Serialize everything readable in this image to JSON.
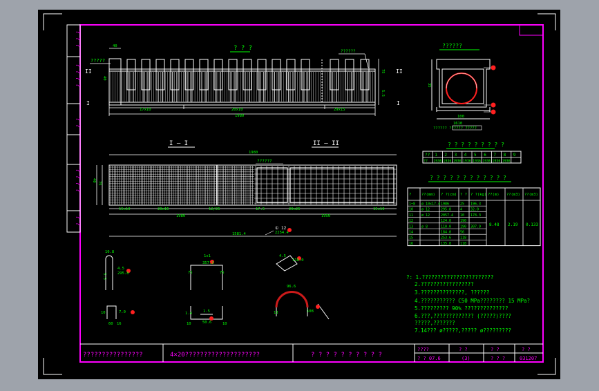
{
  "colors": {
    "outer_bg": "#9ea3ab",
    "sheet_bg": "#000000",
    "frame": "#ff00ff",
    "line": "#ffffff",
    "text": "#00ff00",
    "note_green": "#00ff00",
    "marker": "#ff0000",
    "crimson": "#cc1a1a"
  },
  "side_labels": [
    "? ? ?",
    "? ? ? ?",
    "? ?",
    "? ? ? ?",
    "? ?"
  ],
  "top_view": {
    "title": "? ? ?",
    "left_tag": "?????",
    "right_tag": "??????",
    "left_mark": "II",
    "right_mark": "II",
    "left_mark_b": "I",
    "right_mark_b": "I",
    "dim_top_left": "40",
    "dim_left": "40",
    "dim_right_vals": [
      "75",
      "5.5"
    ],
    "dim_labels": [
      "17x10",
      "20x10",
      "29x15"
    ],
    "total_dim": "1980"
  },
  "cross_section": {
    "title": "??????",
    "callouts": [
      "⑪",
      "⑬",
      "⑪"
    ],
    "dim_labels": [
      "35",
      "100",
      "1610"
    ],
    "bottom_label": "?????? ?????? ?????"
  },
  "section_titles": {
    "sec1": "I — I",
    "sec2": "II — II"
  },
  "long_view": {
    "tag": "??????",
    "total_dim": "1980",
    "left_dims": [
      "40",
      "75"
    ],
    "dim_labels": [
      "15x10",
      "20x15",
      "12/25",
      "17.5",
      "20x25",
      "15x10"
    ],
    "bottom_dims": [
      "1980",
      "1950"
    ],
    "bar_label": "1581.4",
    "bar_callout": "2254.4",
    "bar_tag": "① 12"
  },
  "shapes": {
    "s1": {
      "dims": [
        "10.8",
        "4.5",
        "295.8",
        "5.5"
      ],
      "ball": "⑩"
    },
    "s2": {
      "dims": [
        "1x1",
        "357.3",
        "75",
        "75"
      ],
      "ball": "⑬"
    },
    "s3": {
      "dims": [
        "118.0",
        "4.5"
      ],
      "ball": "⑭"
    },
    "s4": {
      "dims": [
        "7.0",
        "60",
        "10",
        "16"
      ],
      "ball": "⑫"
    },
    "s5": {
      "dims": [
        "1.4",
        "1.5",
        "50.6",
        "10",
        "10"
      ],
      "ball": "⑮"
    },
    "s6": {
      "dims": [
        "96.6",
        "108",
        "13"
      ],
      "ball": "⑨"
    }
  },
  "table1": {
    "title": "? ? ? ? ? ? ? ? ?",
    "header": [
      "??",
      "1",
      "2",
      "3",
      "4",
      "5",
      "6",
      "7",
      "8",
      "9"
    ],
    "row": [
      "??",
      "1936",
      "1936",
      "1936",
      "1936",
      "1936",
      "1936",
      "1936",
      "1936"
    ]
  },
  "table2": {
    "title": "? ? ? ? ? ? ? ? ? ? ? ?",
    "header": [
      "?",
      "??(mm)",
      "? ?(cm)",
      "? ?",
      "? ?(kg)",
      "??(m)",
      "??(m3)",
      "??(m3)"
    ],
    "rows": [
      [
        "1~8",
        "ø 10x17.4",
        "1986",
        "25",
        "196.3"
      ],
      [
        "10",
        "ø 12",
        "295.8",
        "4",
        "32.0"
      ],
      [
        "11",
        "ø 12",
        "2057.4",
        "10",
        "178.3"
      ],
      [
        "12",
        "",
        "124.0",
        "190",
        ""
      ],
      [
        "13",
        "ø 8",
        "110.0",
        "190",
        "307.9"
      ],
      [
        "14",
        "",
        "184.0",
        "56",
        ""
      ],
      [
        "15",
        "",
        "253.6",
        "118",
        ""
      ],
      [
        "16",
        "",
        "135.8",
        "118",
        ""
      ]
    ],
    "merged": [
      "8.48",
      "2.19",
      "0.133"
    ]
  },
  "notes": [
    "?: 1.???????????????????????",
    "2.?????????????????",
    "3.??????????????, ??????",
    "4.???????????     C50 MPa????????     15 MPa?",
    "5.?????????  90%  ??????????????",
    "6.???,?????????????     (?????)????",
    "  ?????,???????",
    "7.14???  ø?????,?????      ø?????????"
  ],
  "title_block": {
    "company": "????????????????",
    "project": "4×20????????????????????",
    "drawing": "? ? ? ? ? ? ? ? ? ?",
    "h_design": "????",
    "h_check": "? ?",
    "h_date": "? ?",
    "h_no": "? ?",
    "v_design": "? ? 07.6",
    "v_check": "(3)",
    "v_date": "? ? ?",
    "v_no": "031207"
  }
}
